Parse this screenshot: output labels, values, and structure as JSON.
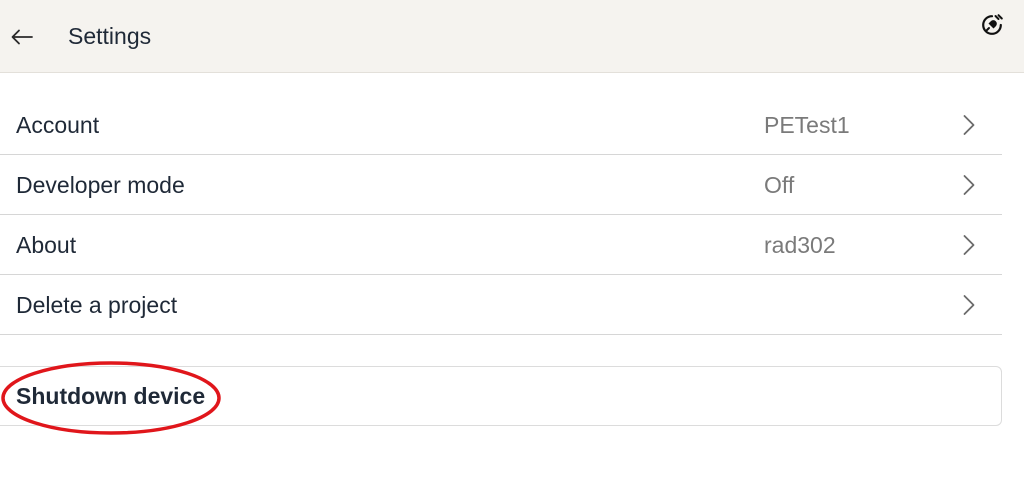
{
  "header": {
    "title": "Settings",
    "back_icon": "arrow-left-icon",
    "power_icon": "power-plug-icon"
  },
  "settings": {
    "items": [
      {
        "label": "Account",
        "value": "PETest1",
        "icon": "chevron-right-icon"
      },
      {
        "label": "Developer mode",
        "value": "Off",
        "icon": "chevron-right-icon"
      },
      {
        "label": "About",
        "value": "rad302",
        "icon": "chevron-right-icon"
      },
      {
        "label": "Delete a project",
        "value": "",
        "icon": "chevron-right-icon"
      }
    ]
  },
  "shutdown": {
    "label": "Shutdown device"
  },
  "colors": {
    "header_bg": "#f5f3ef",
    "divider": "#d6d6d6",
    "value_text": "#7a7a7a",
    "highlight": "#e0161b"
  }
}
